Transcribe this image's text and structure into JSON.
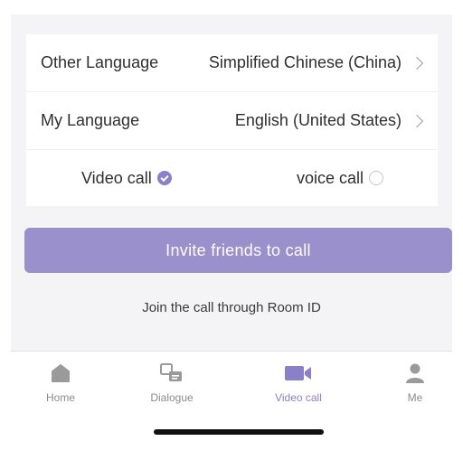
{
  "settings": {
    "other_language": {
      "label": "Other Language",
      "value": "Simplified Chinese (China)"
    },
    "my_language": {
      "label": "My Language",
      "value": "English (United States)"
    }
  },
  "call_type": {
    "video": {
      "label": "Video call",
      "selected": true
    },
    "voice": {
      "label": "voice call",
      "selected": false
    }
  },
  "actions": {
    "invite_label": "Invite friends to call",
    "room_link": "Join the call through Room ID"
  },
  "tabbar": {
    "items": [
      {
        "label": "Home",
        "icon": "home-icon",
        "active": false
      },
      {
        "label": "Dialogue",
        "icon": "dialogue-icon",
        "active": false
      },
      {
        "label": "Video call",
        "icon": "video-camera-icon",
        "active": true
      },
      {
        "label": "Me",
        "icon": "person-icon",
        "active": false
      }
    ]
  },
  "colors": {
    "accent": "#8a80c9",
    "button": "#9990cc",
    "inactive_icon": "#9a9a9a",
    "background": "#f4f4f6"
  }
}
